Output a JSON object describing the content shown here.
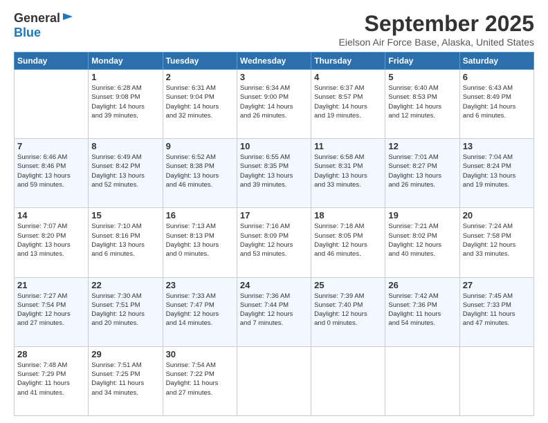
{
  "logo": {
    "general": "General",
    "blue": "Blue"
  },
  "title": "September 2025",
  "subtitle": "Eielson Air Force Base, Alaska, United States",
  "days_header": [
    "Sunday",
    "Monday",
    "Tuesday",
    "Wednesday",
    "Thursday",
    "Friday",
    "Saturday"
  ],
  "weeks": [
    [
      {
        "num": "",
        "info": ""
      },
      {
        "num": "1",
        "info": "Sunrise: 6:28 AM\nSunset: 9:08 PM\nDaylight: 14 hours\nand 39 minutes."
      },
      {
        "num": "2",
        "info": "Sunrise: 6:31 AM\nSunset: 9:04 PM\nDaylight: 14 hours\nand 32 minutes."
      },
      {
        "num": "3",
        "info": "Sunrise: 6:34 AM\nSunset: 9:00 PM\nDaylight: 14 hours\nand 26 minutes."
      },
      {
        "num": "4",
        "info": "Sunrise: 6:37 AM\nSunset: 8:57 PM\nDaylight: 14 hours\nand 19 minutes."
      },
      {
        "num": "5",
        "info": "Sunrise: 6:40 AM\nSunset: 8:53 PM\nDaylight: 14 hours\nand 12 minutes."
      },
      {
        "num": "6",
        "info": "Sunrise: 6:43 AM\nSunset: 8:49 PM\nDaylight: 14 hours\nand 6 minutes."
      }
    ],
    [
      {
        "num": "7",
        "info": "Sunrise: 6:46 AM\nSunset: 8:46 PM\nDaylight: 13 hours\nand 59 minutes."
      },
      {
        "num": "8",
        "info": "Sunrise: 6:49 AM\nSunset: 8:42 PM\nDaylight: 13 hours\nand 52 minutes."
      },
      {
        "num": "9",
        "info": "Sunrise: 6:52 AM\nSunset: 8:38 PM\nDaylight: 13 hours\nand 46 minutes."
      },
      {
        "num": "10",
        "info": "Sunrise: 6:55 AM\nSunset: 8:35 PM\nDaylight: 13 hours\nand 39 minutes."
      },
      {
        "num": "11",
        "info": "Sunrise: 6:58 AM\nSunset: 8:31 PM\nDaylight: 13 hours\nand 33 minutes."
      },
      {
        "num": "12",
        "info": "Sunrise: 7:01 AM\nSunset: 8:27 PM\nDaylight: 13 hours\nand 26 minutes."
      },
      {
        "num": "13",
        "info": "Sunrise: 7:04 AM\nSunset: 8:24 PM\nDaylight: 13 hours\nand 19 minutes."
      }
    ],
    [
      {
        "num": "14",
        "info": "Sunrise: 7:07 AM\nSunset: 8:20 PM\nDaylight: 13 hours\nand 13 minutes."
      },
      {
        "num": "15",
        "info": "Sunrise: 7:10 AM\nSunset: 8:16 PM\nDaylight: 13 hours\nand 6 minutes."
      },
      {
        "num": "16",
        "info": "Sunrise: 7:13 AM\nSunset: 8:13 PM\nDaylight: 13 hours\nand 0 minutes."
      },
      {
        "num": "17",
        "info": "Sunrise: 7:16 AM\nSunset: 8:09 PM\nDaylight: 12 hours\nand 53 minutes."
      },
      {
        "num": "18",
        "info": "Sunrise: 7:18 AM\nSunset: 8:05 PM\nDaylight: 12 hours\nand 46 minutes."
      },
      {
        "num": "19",
        "info": "Sunrise: 7:21 AM\nSunset: 8:02 PM\nDaylight: 12 hours\nand 40 minutes."
      },
      {
        "num": "20",
        "info": "Sunrise: 7:24 AM\nSunset: 7:58 PM\nDaylight: 12 hours\nand 33 minutes."
      }
    ],
    [
      {
        "num": "21",
        "info": "Sunrise: 7:27 AM\nSunset: 7:54 PM\nDaylight: 12 hours\nand 27 minutes."
      },
      {
        "num": "22",
        "info": "Sunrise: 7:30 AM\nSunset: 7:51 PM\nDaylight: 12 hours\nand 20 minutes."
      },
      {
        "num": "23",
        "info": "Sunrise: 7:33 AM\nSunset: 7:47 PM\nDaylight: 12 hours\nand 14 minutes."
      },
      {
        "num": "24",
        "info": "Sunrise: 7:36 AM\nSunset: 7:44 PM\nDaylight: 12 hours\nand 7 minutes."
      },
      {
        "num": "25",
        "info": "Sunrise: 7:39 AM\nSunset: 7:40 PM\nDaylight: 12 hours\nand 0 minutes."
      },
      {
        "num": "26",
        "info": "Sunrise: 7:42 AM\nSunset: 7:36 PM\nDaylight: 11 hours\nand 54 minutes."
      },
      {
        "num": "27",
        "info": "Sunrise: 7:45 AM\nSunset: 7:33 PM\nDaylight: 11 hours\nand 47 minutes."
      }
    ],
    [
      {
        "num": "28",
        "info": "Sunrise: 7:48 AM\nSunset: 7:29 PM\nDaylight: 11 hours\nand 41 minutes."
      },
      {
        "num": "29",
        "info": "Sunrise: 7:51 AM\nSunset: 7:25 PM\nDaylight: 11 hours\nand 34 minutes."
      },
      {
        "num": "30",
        "info": "Sunrise: 7:54 AM\nSunset: 7:22 PM\nDaylight: 11 hours\nand 27 minutes."
      },
      {
        "num": "",
        "info": ""
      },
      {
        "num": "",
        "info": ""
      },
      {
        "num": "",
        "info": ""
      },
      {
        "num": "",
        "info": ""
      }
    ]
  ]
}
